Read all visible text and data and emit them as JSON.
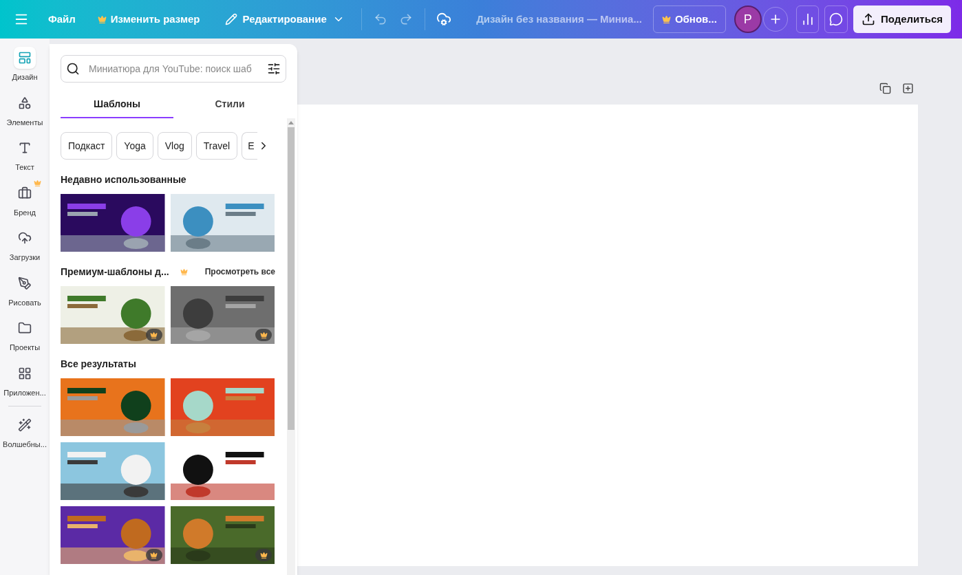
{
  "topbar": {
    "menu": [
      {
        "label": "Файл",
        "premium": false
      },
      {
        "label": "Изменить размер",
        "premium": true
      }
    ],
    "mode": "Редактирование",
    "title": "Дизайн без названия — Миниа...",
    "upgrade": "Обнов...",
    "avatar": "P",
    "share": "Поделиться"
  },
  "rail": [
    {
      "label": "Дизайн",
      "selected": true,
      "premium": false,
      "kind": "design"
    },
    {
      "label": "Элементы",
      "selected": false,
      "premium": false,
      "kind": "elements"
    },
    {
      "label": "Текст",
      "selected": false,
      "premium": false,
      "kind": "text"
    },
    {
      "label": "Бренд",
      "selected": false,
      "premium": true,
      "kind": "brand"
    },
    {
      "label": "Загрузки",
      "selected": false,
      "premium": false,
      "kind": "uploads"
    },
    {
      "label": "Рисовать",
      "selected": false,
      "premium": false,
      "kind": "draw"
    },
    {
      "label": "Проекты",
      "selected": false,
      "premium": false,
      "kind": "projects"
    },
    {
      "label": "Приложен...",
      "selected": false,
      "premium": false,
      "kind": "apps"
    },
    {
      "label": "Волшебны...",
      "selected": false,
      "premium": false,
      "kind": "magic"
    }
  ],
  "panel": {
    "search": {
      "placeholder": "Миниатюра для YouTube: поиск шаб"
    },
    "tabs": [
      {
        "label": "Шаблоны",
        "selected": true
      },
      {
        "label": "Стили",
        "selected": false
      }
    ],
    "chips": [
      "Подкаст",
      "Yoga",
      "Vlog",
      "Travel",
      "E"
    ],
    "sections": [
      {
        "title": "Недавно использованные",
        "items": [
          {
            "kind": "picture",
            "premium": false
          },
          {
            "kind": "picture",
            "premium": false
          }
        ]
      },
      {
        "title": "Премиум-шаблоны д...",
        "premium_mark": true,
        "link": "Просмотреть все",
        "items": [
          {
            "kind": "picture",
            "premium": true
          },
          {
            "kind": "picture",
            "premium": true
          }
        ]
      },
      {
        "title": "Все результаты",
        "items": [
          {
            "kind": "picture",
            "premium": false
          },
          {
            "kind": "picture",
            "premium": false
          },
          {
            "kind": "picture",
            "premium": false
          },
          {
            "kind": "picture",
            "premium": false
          },
          {
            "kind": "picture",
            "premium": true
          },
          {
            "kind": "picture",
            "premium": true
          }
        ]
      }
    ]
  }
}
